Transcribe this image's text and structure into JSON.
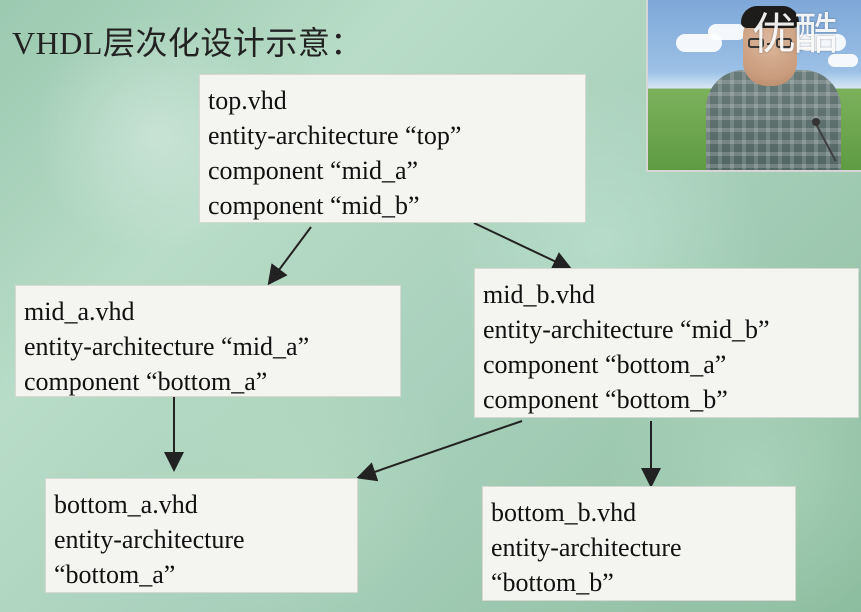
{
  "title": "VHDL层次化设计示意：",
  "watermark_text": "优酷",
  "nodes": {
    "top": {
      "lines": [
        "top.vhd",
        "entity-architecture “top”",
        "component “mid_a”",
        "component “mid_b”"
      ]
    },
    "mid_a": {
      "lines": [
        "mid_a.vhd",
        "entity-architecture “mid_a”",
        "component “bottom_a”"
      ]
    },
    "mid_b": {
      "lines": [
        "mid_b.vhd",
        "entity-architecture “mid_b”",
        "component “bottom_a”",
        "component “bottom_b”"
      ]
    },
    "bottom_a": {
      "lines": [
        "bottom_a.vhd",
        "entity-architecture",
        "“bottom_a”"
      ]
    },
    "bottom_b": {
      "lines": [
        "bottom_b.vhd",
        "entity-architecture",
        "“bottom_b”"
      ]
    }
  },
  "colors": {
    "arrow": "#222222",
    "box_background": "#f4f4f1",
    "text": "#111111"
  }
}
